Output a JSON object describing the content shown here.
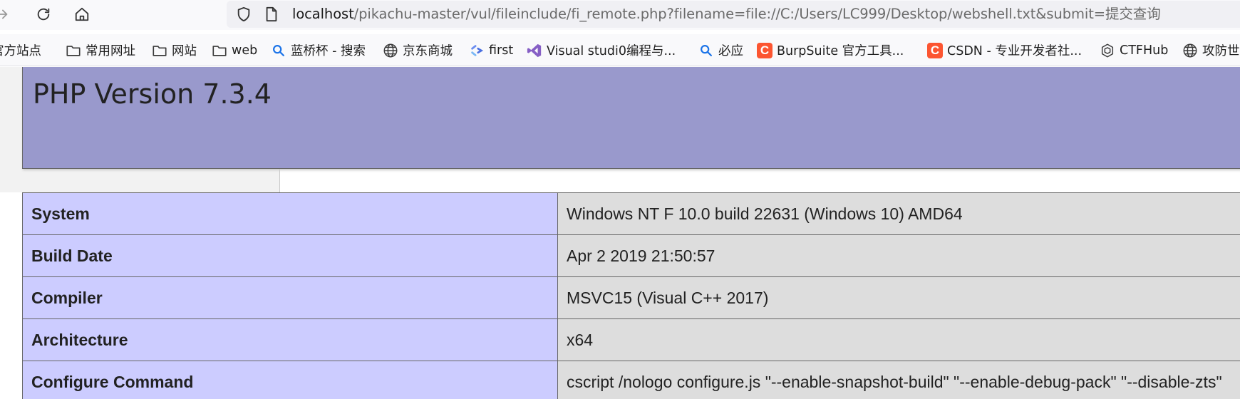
{
  "browser": {
    "address_bar": {
      "host": "localhost",
      "path": "/pikachu-master/vul/fileinclude/fi_remote.php?filename=file://C:/Users/LC999/Desktop/webshell.txt&submit=提交查询"
    },
    "bookmarks": [
      {
        "label": "官方站点",
        "icon": "folder-icon"
      },
      {
        "label": "常用网址",
        "icon": "folder-icon"
      },
      {
        "label": "网站",
        "icon": "folder-icon"
      },
      {
        "label": "web",
        "icon": "folder-icon"
      },
      {
        "label": "蓝桥杯 - 搜索",
        "icon": "search-icon"
      },
      {
        "label": "京东商城",
        "icon": "globe-icon"
      },
      {
        "label": "first",
        "icon": "link-icon"
      },
      {
        "label": "Visual studi0编程与...",
        "icon": "visual-studio-icon"
      },
      {
        "label": "必应",
        "icon": "search-icon"
      },
      {
        "label": "BurpSuite 官方工具...",
        "icon": "csdn-icon"
      },
      {
        "label": "CSDN - 专业开发者社...",
        "icon": "csdn-icon"
      },
      {
        "label": "CTFHub",
        "icon": "ctfhub-icon"
      },
      {
        "label": "攻防世",
        "icon": "globe-icon"
      }
    ],
    "csdn_letter": "C",
    "colors": {
      "csdn": "#fc5531",
      "search": "#1a73e8"
    }
  },
  "page": {
    "title": "PHP Version 7.3.4",
    "colors": {
      "header_bg": "#9999cc",
      "label_bg": "#ccccff",
      "value_bg": "#dddddd"
    },
    "rows": [
      {
        "label": "System",
        "value": "Windows NT F 10.0 build 22631 (Windows 10) AMD64"
      },
      {
        "label": "Build Date",
        "value": "Apr 2 2019 21:50:57"
      },
      {
        "label": "Compiler",
        "value": "MSVC15 (Visual C++ 2017)"
      },
      {
        "label": "Architecture",
        "value": "x64"
      },
      {
        "label": "Configure Command",
        "value": "cscript /nologo configure.js \"--enable-snapshot-build\" \"--enable-debug-pack\" \"--disable-zts\""
      }
    ]
  }
}
